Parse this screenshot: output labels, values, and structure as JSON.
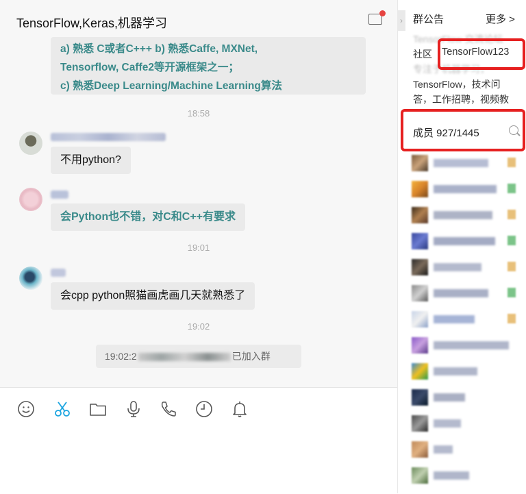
{
  "chat": {
    "title": "TensorFlow,Keras,机器学习",
    "top_message_lines": [
      "a)    熟悉 C或者C+++  b)      熟悉Caffe, MXNet,",
      "Tensorflow, Caffe2等开源框架之一；",
      "c)       熟悉Deep Learning/Machine Learning算法"
    ],
    "times": [
      "18:58",
      "19:01",
      "19:02"
    ],
    "messages": [
      {
        "text": "不用python?"
      },
      {
        "text": "会Python也不错，对C和C++有要求"
      },
      {
        "text": "会cpp python照猫画虎画几天就熟悉了"
      }
    ],
    "system_notice": {
      "prefix": "19:02:2",
      "suffix": "已加入群"
    }
  },
  "toolbar": {
    "icons": [
      "smiley-icon",
      "scissors-icon",
      "folder-icon",
      "microphone-icon",
      "phone-icon",
      "clock-icon",
      "bell-icon"
    ],
    "active_color": "#1aa4e0"
  },
  "sidebar": {
    "title": "群公告",
    "more_label": "更多 >",
    "intro_line1_blurred": "TensorFlow 交流论坛",
    "intro_prefix": "社区 ",
    "intro_highlight": "TensorFlow123",
    "intro_line3": "专注于机器学习，",
    "intro_line4": "TensorFlow，技术问",
    "intro_line5": "答，工作招聘，视频教",
    "members_label": "成员 927/1445",
    "highlight_color": "#e62020"
  }
}
